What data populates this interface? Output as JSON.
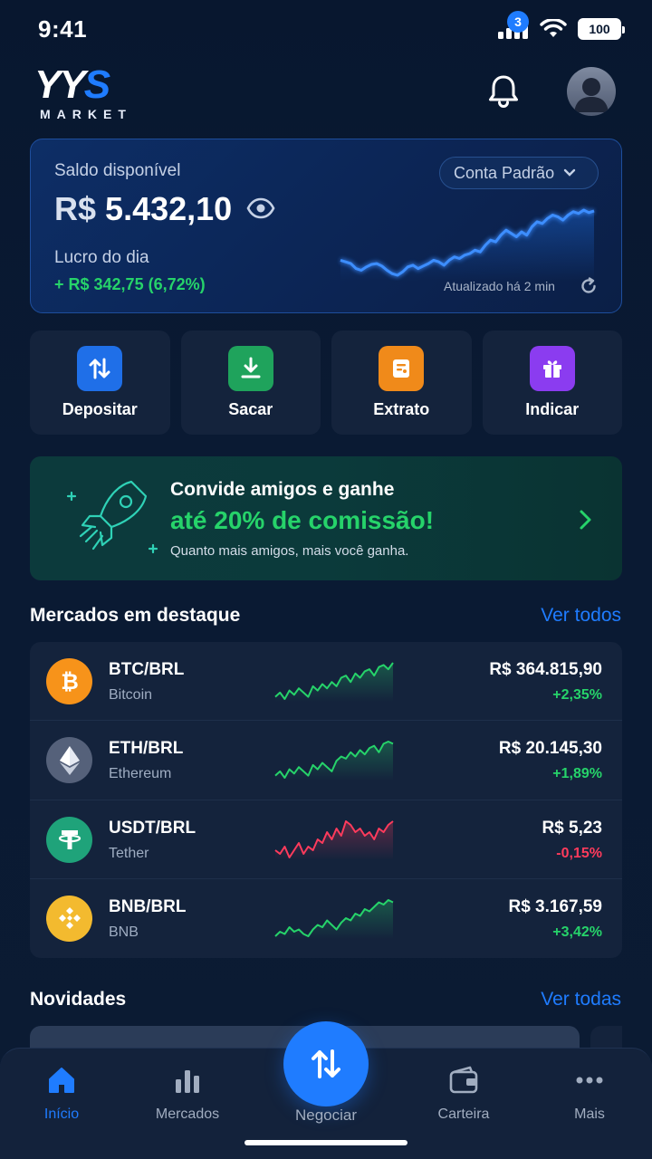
{
  "status_bar": {
    "time": "9:41",
    "battery": "100"
  },
  "header": {
    "logo_primary": "YY",
    "logo_accent": "S",
    "logo_sub": "MARKET",
    "notification_count": "3"
  },
  "balance": {
    "label": "Saldo disponível",
    "currency": "R$",
    "amount": "5.432,10",
    "account_select": "Conta Padrão",
    "profit_label": "Lucro do dia",
    "profit_value": "+ R$ 342,75 (6,72%)",
    "updated": "Atualizado há 2 min",
    "trend": [
      40,
      38,
      36,
      30,
      28,
      32,
      35,
      36,
      33,
      28,
      24,
      22,
      26,
      32,
      34,
      30,
      33,
      36,
      40,
      38,
      34,
      40,
      44,
      42,
      46,
      48,
      52,
      50,
      58,
      64,
      62,
      70,
      76,
      72,
      68,
      74,
      70,
      80,
      86,
      84,
      90,
      94,
      92,
      88,
      94,
      98,
      96,
      100,
      97,
      99
    ]
  },
  "actions": [
    {
      "label": "Depositar",
      "icon": "deposit-icon",
      "color": "#1f6fe8"
    },
    {
      "label": "Sacar",
      "icon": "withdraw-icon",
      "color": "#1fa35c"
    },
    {
      "label": "Extrato",
      "icon": "statement-icon",
      "color": "#f08a1a"
    },
    {
      "label": "Indicar",
      "icon": "gift-icon",
      "color": "#8b3cf0"
    }
  ],
  "promo": {
    "title": "Convide amigos e ganhe",
    "highlight": "até 20% de comissão!",
    "subtitle": "Quanto mais amigos, mais você ganha."
  },
  "markets": {
    "title": "Mercados em destaque",
    "link": "Ver todos",
    "items": [
      {
        "pair": "BTC/BRL",
        "name": "Bitcoin",
        "price": "R$ 364.815,90",
        "change": "+2,35%",
        "trend": "up",
        "icon": "bitcoin-icon",
        "icon_color": "#f7931a",
        "spark": [
          20,
          24,
          18,
          26,
          22,
          28,
          24,
          20,
          30,
          26,
          32,
          28,
          34,
          30,
          38,
          40,
          34,
          42,
          38,
          44,
          46,
          40,
          48,
          50,
          46,
          52
        ]
      },
      {
        "pair": "ETH/BRL",
        "name": "Ethereum",
        "price": "R$ 20.145,30",
        "change": "+1,89%",
        "trend": "up",
        "icon": "ethereum-icon",
        "icon_color": "#55617a",
        "spark": [
          18,
          22,
          16,
          24,
          20,
          26,
          22,
          18,
          28,
          24,
          30,
          26,
          22,
          32,
          36,
          34,
          40,
          36,
          42,
          38,
          44,
          46,
          40,
          48,
          50,
          48
        ]
      },
      {
        "pair": "USDT/BRL",
        "name": "Tether",
        "price": "R$ 5,23",
        "change": "-0,15%",
        "trend": "down",
        "icon": "tether-icon",
        "icon_color": "#1fa37a",
        "spark": [
          30,
          28,
          32,
          26,
          30,
          34,
          28,
          32,
          30,
          36,
          34,
          40,
          36,
          42,
          38,
          46,
          44,
          40,
          42,
          38,
          40,
          36,
          42,
          40,
          44,
          46
        ]
      },
      {
        "pair": "BNB/BRL",
        "name": "BNB",
        "price": "R$ 3.167,59",
        "change": "+3,42%",
        "trend": "up",
        "icon": "bnb-icon",
        "icon_color": "#f3ba2f",
        "spark": [
          20,
          24,
          22,
          28,
          24,
          26,
          22,
          20,
          26,
          30,
          28,
          34,
          30,
          26,
          32,
          36,
          34,
          40,
          38,
          44,
          42,
          46,
          50,
          48,
          52,
          50
        ]
      }
    ]
  },
  "news": {
    "title": "Novidades",
    "link": "Ver todas"
  },
  "nav": {
    "items": [
      {
        "label": "Início",
        "icon": "home-icon",
        "active": true
      },
      {
        "label": "Mercados",
        "icon": "markets-icon",
        "active": false
      },
      {
        "label": "Negociar",
        "icon": "trade-icon",
        "active": false
      },
      {
        "label": "Carteira",
        "icon": "wallet-icon",
        "active": false
      },
      {
        "label": "Mais",
        "icon": "more-icon",
        "active": false
      }
    ]
  },
  "colors": {
    "accent": "#1f7cff",
    "positive": "#26d36a",
    "negative": "#ff3b5c",
    "surface": "#14233c"
  }
}
